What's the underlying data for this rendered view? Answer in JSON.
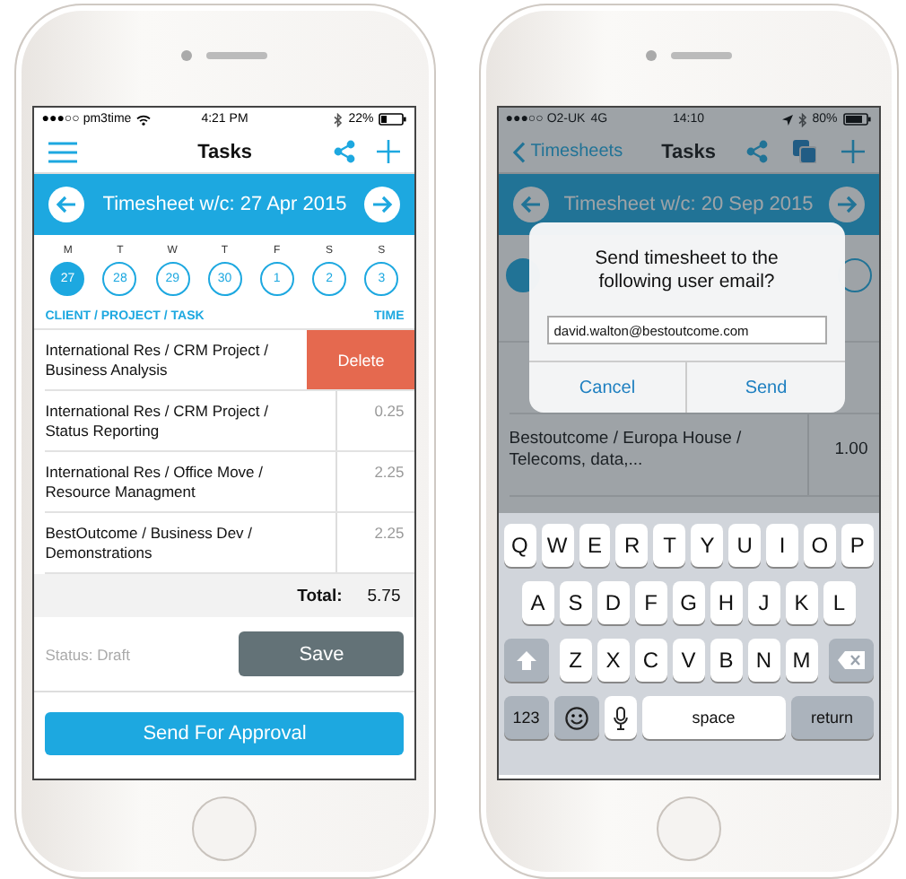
{
  "left_phone": {
    "status_bar": {
      "carrier": "●●●○○ pm3time",
      "time": "4:21 PM",
      "battery": "22%"
    },
    "nav": {
      "title": "Tasks"
    },
    "week_bar": {
      "title": "Timesheet w/c: 27 Apr 2015"
    },
    "days": [
      {
        "letter": "M",
        "date": "27",
        "selected": true
      },
      {
        "letter": "T",
        "date": "28",
        "selected": false
      },
      {
        "letter": "W",
        "date": "29",
        "selected": false
      },
      {
        "letter": "T",
        "date": "30",
        "selected": false
      },
      {
        "letter": "F",
        "date": "1",
        "selected": false
      },
      {
        "letter": "S",
        "date": "2",
        "selected": false
      },
      {
        "letter": "S",
        "date": "3",
        "selected": false
      }
    ],
    "columns": {
      "task": "CLIENT / PROJECT / TASK",
      "time": "TIME"
    },
    "rows": [
      {
        "task": "International Res / CRM Project / Business Analysis",
        "delete_shown": true,
        "delete_label": "Delete"
      },
      {
        "task": "International Res / CRM Project / Status Reporting",
        "delete_shown": false,
        "time": "0.25"
      },
      {
        "task": "International Res / Office Move / Resource Managment",
        "delete_shown": false,
        "time": "2.25"
      },
      {
        "task": "BestOutcome / Business Dev / Demonstrations",
        "delete_shown": false,
        "time": "2.25"
      }
    ],
    "total": {
      "label": "Total:",
      "value": "5.75"
    },
    "status": "Status: Draft",
    "save_button": "Save",
    "send_button": "Send For Approval"
  },
  "right_phone": {
    "status_bar": {
      "carrier": "●●●○○ O2-UK",
      "network": "4G",
      "time": "14:10",
      "battery": "80%"
    },
    "nav": {
      "back": "Timesheets",
      "title": "Tasks"
    },
    "week_bar": {
      "title": "Timesheet w/c: 20 Sep 2015"
    },
    "rows": [
      {
        "task": "Bestoutcome / Europa House / Telecoms, data,...",
        "time": "1.00"
      }
    ],
    "dialog": {
      "message": "Send timesheet to the following user email?",
      "email": "david.walton@bestoutcome.com",
      "cancel": "Cancel",
      "send": "Send"
    },
    "keyboard": {
      "rows": [
        [
          "Q",
          "W",
          "E",
          "R",
          "T",
          "Y",
          "U",
          "I",
          "O",
          "P"
        ],
        [
          "A",
          "S",
          "D",
          "F",
          "G",
          "H",
          "J",
          "K",
          "L"
        ],
        [
          "Z",
          "X",
          "C",
          "V",
          "B",
          "N",
          "M"
        ]
      ],
      "numbers_key": "123",
      "space_key": "space",
      "return_key": "return"
    }
  }
}
